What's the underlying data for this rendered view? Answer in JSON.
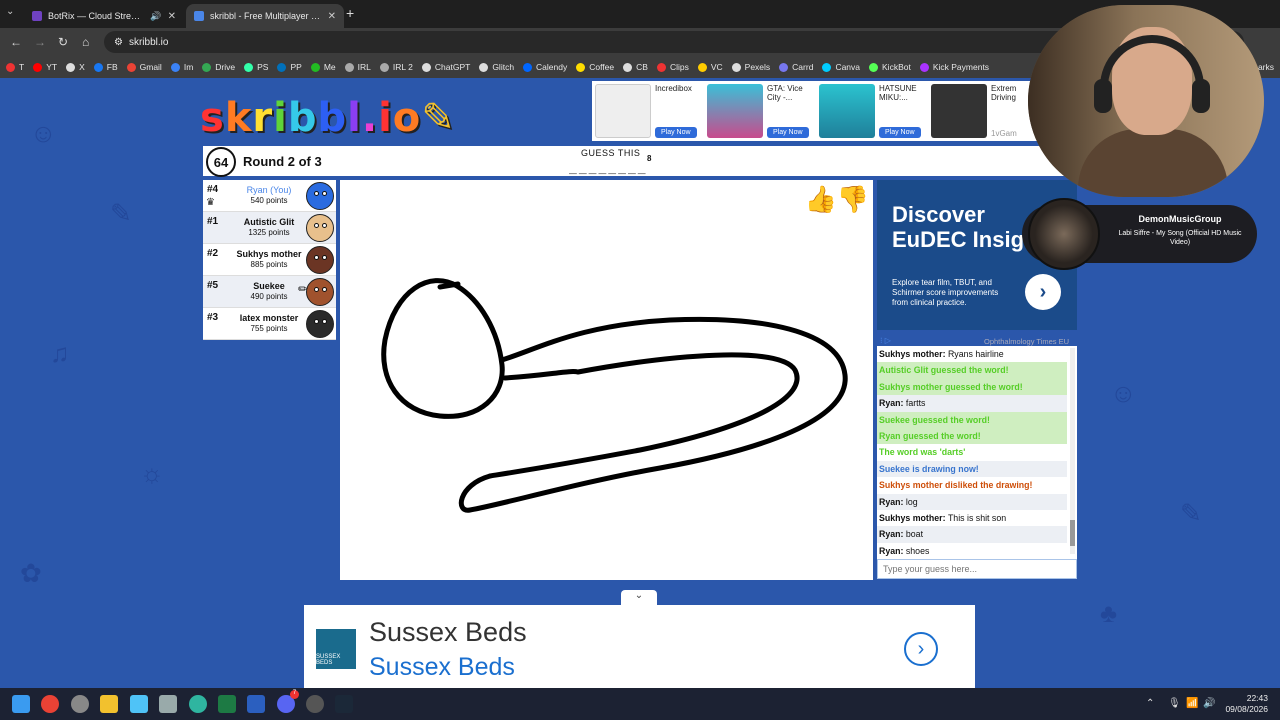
{
  "browser": {
    "tabs": [
      {
        "title": "BotRix — Cloud Streaming",
        "icon_color": "#6f42c1",
        "audio": "speaker-icon"
      },
      {
        "title": "skribbl - Free Multiplayer Draw",
        "icon_color": "#4a86e8"
      }
    ],
    "url": "skribbl.io",
    "bookmarks": [
      {
        "label": "T",
        "color": "#e33"
      },
      {
        "label": "YT",
        "color": "#f00"
      },
      {
        "label": "X",
        "color": "#ddd"
      },
      {
        "label": "FB",
        "color": "#1877f2"
      },
      {
        "label": "Gmail",
        "color": "#ea4335"
      },
      {
        "label": "Im",
        "color": "#3b82f6"
      },
      {
        "label": "Drive",
        "color": "#34a853"
      },
      {
        "label": "PS",
        "color": "#3fa"
      },
      {
        "label": "PP",
        "color": "#0070ba"
      },
      {
        "label": "Me",
        "color": "#2b2"
      },
      {
        "label": "IRL",
        "color": "#aaa"
      },
      {
        "label": "IRL 2",
        "color": "#aaa"
      },
      {
        "label": "ChatGPT",
        "color": "#ddd"
      },
      {
        "label": "Glitch",
        "color": "#ddd"
      },
      {
        "label": "Calendy",
        "color": "#06f"
      },
      {
        "label": "Coffee",
        "color": "#fd0"
      },
      {
        "label": "CB",
        "color": "#ddd"
      },
      {
        "label": "Clips",
        "color": "#e33"
      },
      {
        "label": "VC",
        "color": "#fc0"
      },
      {
        "label": "Pexels",
        "color": "#ddd"
      },
      {
        "label": "Carrd",
        "color": "#77e"
      },
      {
        "label": "Canva",
        "color": "#0cf"
      },
      {
        "label": "KickBot",
        "color": "#5f5"
      },
      {
        "label": "Kick Payments",
        "color": "#a3f"
      }
    ],
    "bookmarks_overflow": "marks"
  },
  "ads": {
    "top": [
      {
        "title": "Incredibox",
        "cta": "Play Now",
        "color": "#f4f4f4"
      },
      {
        "title": "GTA: Vice City -...",
        "cta": "Play Now",
        "color": "#1fa0b8"
      },
      {
        "title": "HATSUNE MIKU:...",
        "cta": "Play Now",
        "color": "#29b9c9"
      }
    ],
    "top_partial": {
      "title": "Extrem Driving",
      "source": "1vGam"
    },
    "right": {
      "headline": "Discover\nEuDEC Insig",
      "desc": "Explore tear film, TBUT, and Schirmer score improvements from clinical practice.",
      "source": "Ophthalmology Times EU"
    },
    "bottom": {
      "title": "Sussex Beds",
      "subtitle": "Sussex Beds",
      "logo_text": "SUSSEX BEDS"
    }
  },
  "game": {
    "timer": "64",
    "round": "Round 2 of 3",
    "guess_label": "GUESS THIS",
    "word_hint": "________",
    "word_length": "8",
    "players": [
      {
        "rank": "#4",
        "name": "Ryan (You)",
        "points": "540 points",
        "you": true,
        "crown": true,
        "avatar": "#2a6be0"
      },
      {
        "rank": "#1",
        "name": "Autistic Glit",
        "points": "1325 points",
        "avatar": "#e8c08c"
      },
      {
        "rank": "#2",
        "name": "Sukhys mother",
        "points": "885 points",
        "avatar": "#6b3524"
      },
      {
        "rank": "#5",
        "name": "Suekee",
        "points": "490 points",
        "avatar": "#a0522d",
        "drawing": true
      },
      {
        "rank": "#3",
        "name": "latex monster",
        "points": "755 points",
        "avatar": "#2a2a2a"
      }
    ],
    "chat": [
      {
        "who": "Sukhys mother",
        "text": "Ryans hairline",
        "style": "normal"
      },
      {
        "who": "",
        "text": "Autistic Glit guessed the word!",
        "style": "green"
      },
      {
        "who": "",
        "text": "Sukhys mother guessed the word!",
        "style": "green"
      },
      {
        "who": "Ryan",
        "text": "fartts",
        "style": "normal"
      },
      {
        "who": "",
        "text": "Suekee guessed the word!",
        "style": "green"
      },
      {
        "who": "",
        "text": "Ryan guessed the word!",
        "style": "green"
      },
      {
        "who": "",
        "text": "The word was 'darts'",
        "style": "greentext"
      },
      {
        "who": "",
        "text": "Suekee is drawing now!",
        "style": "blue"
      },
      {
        "who": "",
        "text": "Sukhys mother disliked the drawing!",
        "style": "orange"
      },
      {
        "who": "Ryan",
        "text": "log",
        "style": "normal"
      },
      {
        "who": "Sukhys mother",
        "text": "This is shit son",
        "style": "normal"
      },
      {
        "who": "Ryan",
        "text": "boat",
        "style": "normal"
      },
      {
        "who": "Ryan",
        "text": "shoes",
        "style": "normal"
      }
    ],
    "chat_placeholder": "Type your guess here..."
  },
  "overlay": {
    "music_artist": "DemonMusicGroup",
    "music_song": "Labi Siffre - My Song (Official HD Music Video)"
  },
  "taskbar": {
    "time": "22:43",
    "date": "09/08/2026",
    "discord_badge": "7"
  }
}
